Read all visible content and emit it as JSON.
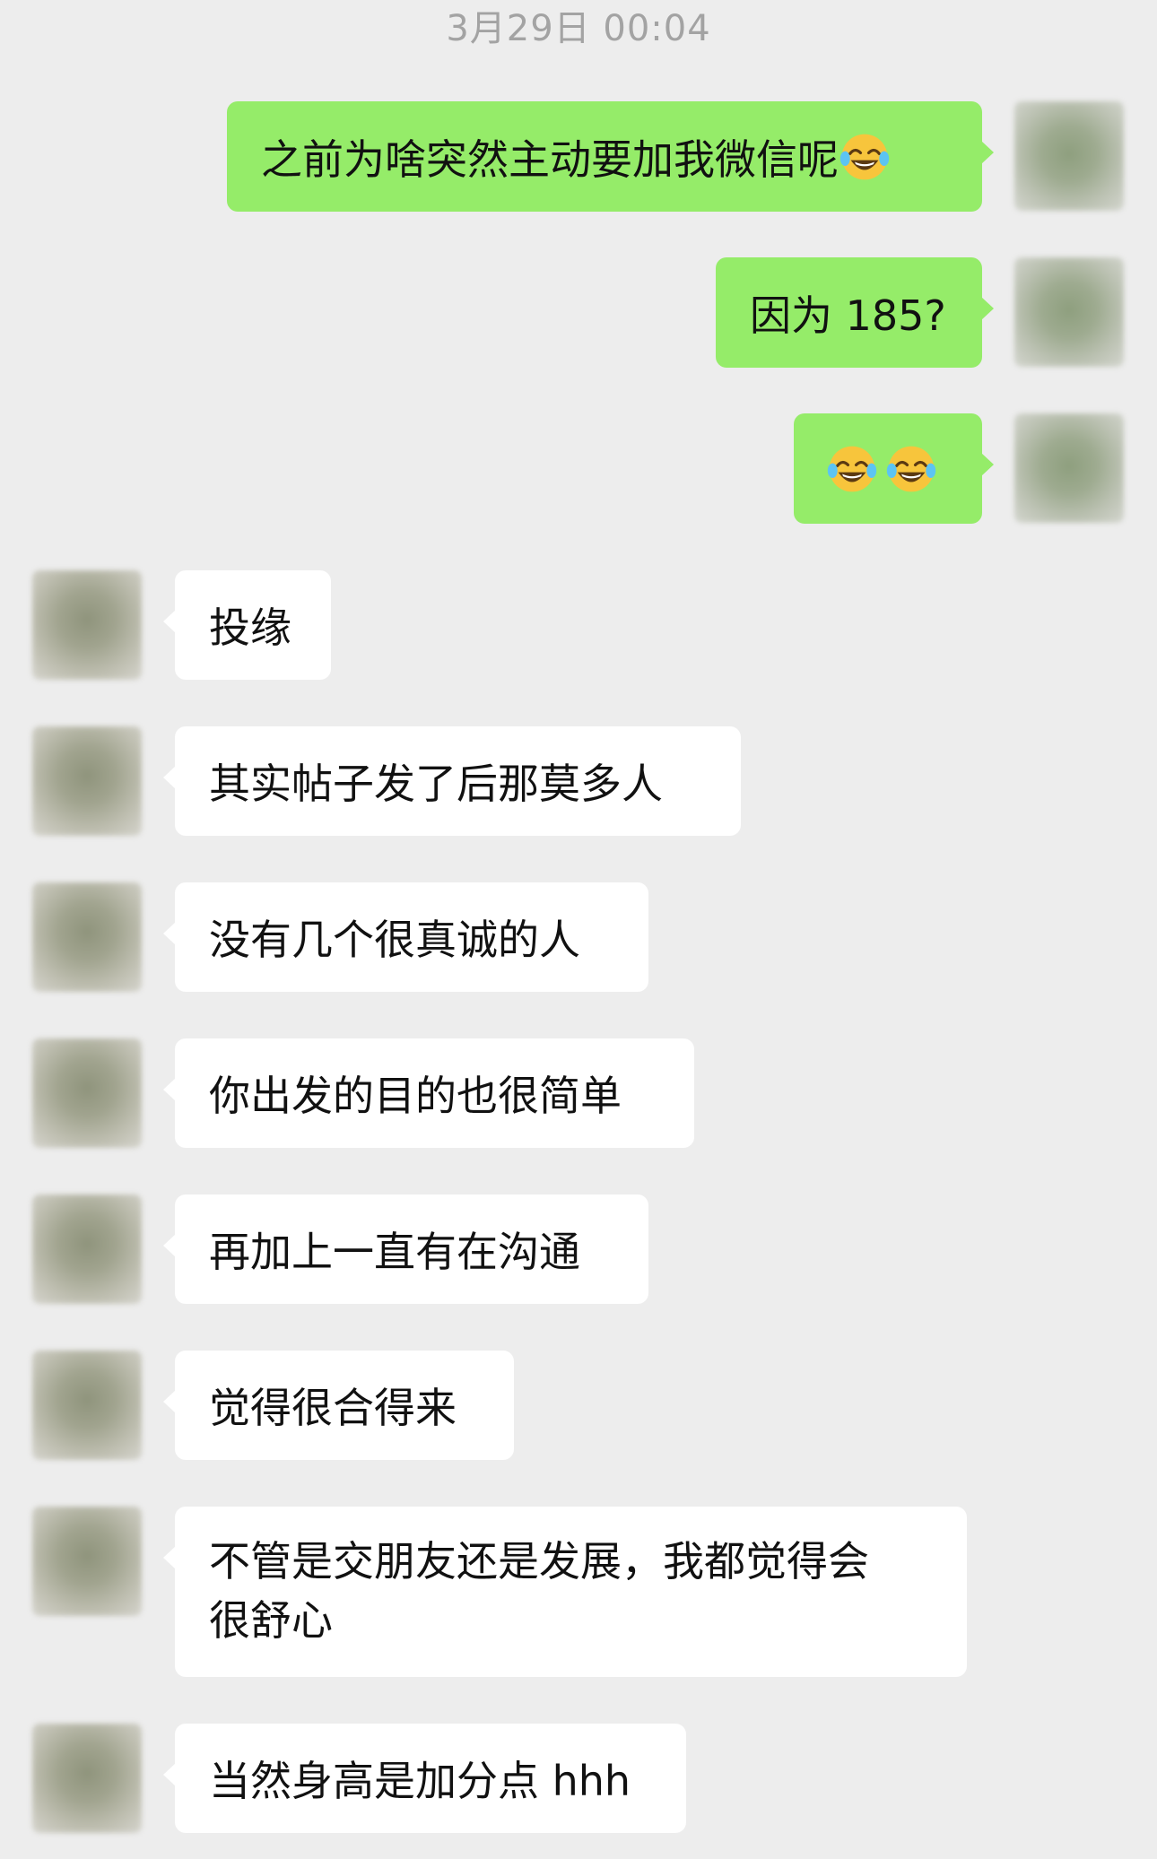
{
  "chat": {
    "timestamp": "3月29日 00:04",
    "messages": [
      {
        "side": "out",
        "text": "之前为啥突然主动要加我微信呢",
        "emoji": "face-with-tears-of-joy"
      },
      {
        "side": "out",
        "text": "因为 185?"
      },
      {
        "side": "out",
        "text": "",
        "emoji_count": 2,
        "emoji": "face-with-tears-of-joy"
      },
      {
        "side": "in",
        "text": "投缘"
      },
      {
        "side": "in",
        "text": "其实帖子发了后那莫多人"
      },
      {
        "side": "in",
        "text": "没有几个很真诚的人"
      },
      {
        "side": "in",
        "text": "你出发的目的也很简单"
      },
      {
        "side": "in",
        "text": "再加上一直有在沟通"
      },
      {
        "side": "in",
        "text": "觉得很合得来"
      },
      {
        "side": "in",
        "text": "不管是交朋友还是发展，我都觉得会\n很舒心"
      },
      {
        "side": "in",
        "text": "当然身高是加分点 hhh"
      }
    ]
  },
  "colors": {
    "background": "#ededed",
    "outgoing_bubble": "#95ec69",
    "incoming_bubble": "#ffffff",
    "timestamp_text": "#a3a3a3"
  }
}
